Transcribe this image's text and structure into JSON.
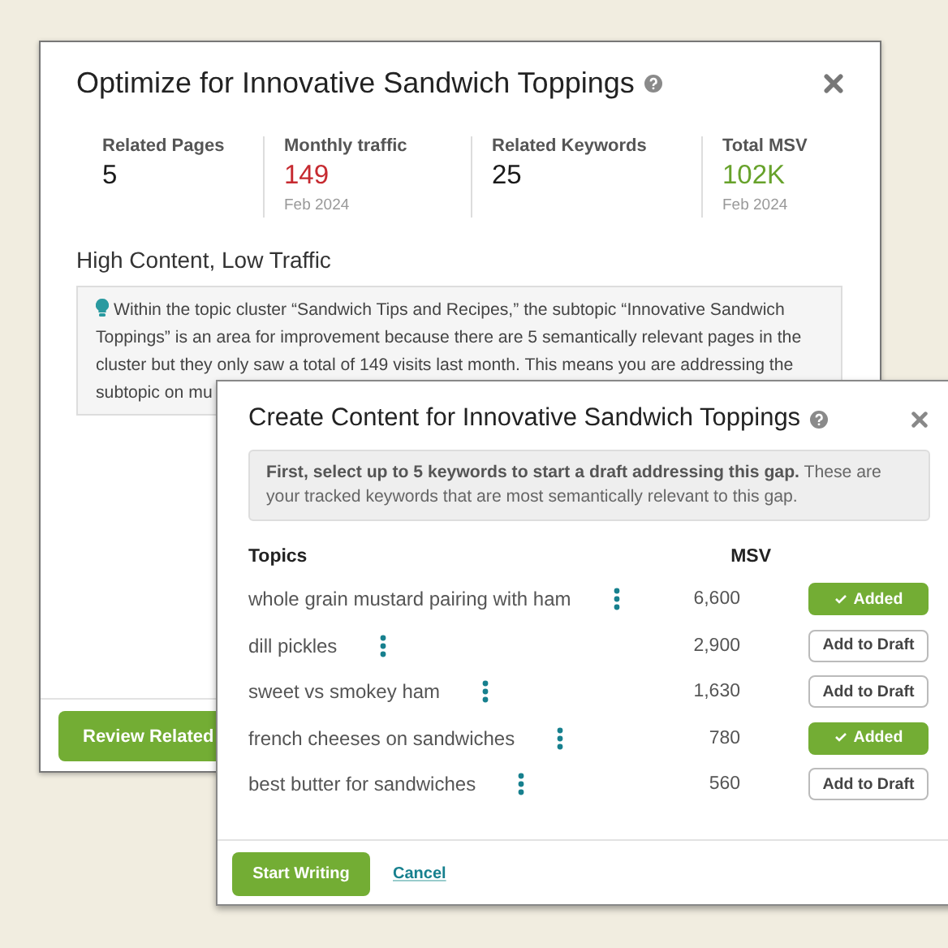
{
  "back_dialog": {
    "title": "Optimize for Innovative Sandwich Toppings",
    "stats": [
      {
        "label": "Related Pages",
        "value": "5",
        "color": "#1a1a1a"
      },
      {
        "label": "Monthly traffic",
        "value": "149",
        "note": "Feb 2024",
        "color": "#c62a30"
      },
      {
        "label": "Related Keywords",
        "value": "25",
        "color": "#1a1a1a"
      },
      {
        "label": "Total MSV",
        "value": "102K",
        "note": "Feb 2024",
        "color": "#67a22b"
      }
    ],
    "section_title": "High Content, Low Traffic",
    "insight": "Within the topic cluster “Sandwich Tips and Recipes,” the subtopic “Innovative Sandwich Toppings” is an area for improvement because there are 5 semantically relevant pages in the cluster but they only saw a total of 149 visits last month. This means you are addressing the subtopic on mu",
    "primary_button": "Review Related"
  },
  "front_dialog": {
    "title": "Create Content for Innovative Sandwich Toppings",
    "info": "**First, select up to 5 keywords to start a draft addressing this gap.** These are your tracked keywords that are most semantically relevant to this gap.",
    "columns": [
      "Topics",
      "MSV"
    ],
    "rows": [
      {
        "topic": "whole grain mustard pairing with ham",
        "msv": "6,600",
        "added": true,
        "button": "Added"
      },
      {
        "topic": "dill pickles",
        "msv": "2,900",
        "added": false,
        "button": "Add to Draft"
      },
      {
        "topic": "sweet vs smokey ham",
        "msv": "1,630",
        "added": false,
        "button": "Add to Draft"
      },
      {
        "topic": "french cheeses on sandwiches",
        "msv": "780",
        "added": true,
        "button": "Added"
      },
      {
        "topic": "best butter for sandwiches",
        "msv": "560",
        "added": false,
        "button": "Add to Draft"
      }
    ],
    "primary_button": "Start Writing",
    "cancel_link": "Cancel"
  }
}
